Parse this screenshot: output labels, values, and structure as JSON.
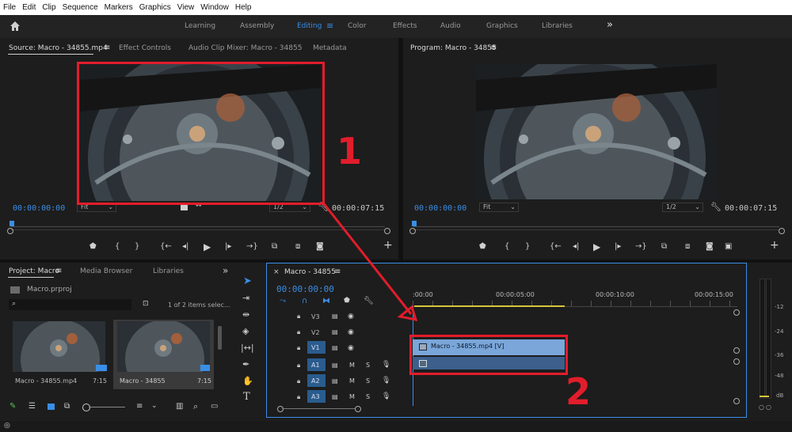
{
  "menu": [
    "File",
    "Edit",
    "Clip",
    "Sequence",
    "Markers",
    "Graphics",
    "View",
    "Window",
    "Help"
  ],
  "workspaces": {
    "items": [
      "Learning",
      "Assembly",
      "Editing",
      "Color",
      "Effects",
      "Audio",
      "Graphics",
      "Libraries"
    ],
    "active": "Editing",
    "more": "»"
  },
  "source": {
    "tabs": [
      "Source: Macro - 34855.mp4",
      "Effect Controls",
      "Audio Clip Mixer: Macro - 34855",
      "Metadata"
    ],
    "timecode_in": "00:00:00:00",
    "fit": "Fit",
    "resolution": "1/2",
    "timecode_dur": "00:00:07:15"
  },
  "program": {
    "tab": "Program: Macro - 34855",
    "timecode_in": "00:00:00:00",
    "fit": "Fit",
    "resolution": "1/2",
    "timecode_dur": "00:00:07:15"
  },
  "project": {
    "tabs": [
      "Project: Macro",
      "Media Browser",
      "Libraries"
    ],
    "file": "Macro.prproj",
    "count": "1 of 2 items selec...",
    "items": [
      {
        "name": "Macro - 34855.mp4",
        "duration": "7:15"
      },
      {
        "name": "Macro - 34855",
        "duration": "7:15"
      }
    ]
  },
  "timeline": {
    "tab": "Macro - 34855",
    "timecode": "00:00:00:00",
    "ruler": [
      "",
      ":00:00",
      "00:00:05:00",
      "00:00:10:00",
      "00:00:15:00"
    ],
    "video_tracks": [
      "V3",
      "V2",
      "V1"
    ],
    "audio_tracks": [
      "A1",
      "A2",
      "A3"
    ],
    "v1_active": "V1",
    "a1_active": "A1",
    "video_clip": "Macro - 34855.mp4 [V]",
    "mute": "M",
    "solo": "S"
  },
  "meter": {
    "labels": [
      "-12",
      "-24",
      "-36",
      "-48",
      "dB"
    ]
  },
  "annotations": {
    "one": "1",
    "two": "2"
  },
  "colors": {
    "accent": "#3a8ee6",
    "annotation": "#e21d2b",
    "clip_video": "#7aa6d9",
    "clip_audio": "#3c5f8c"
  }
}
